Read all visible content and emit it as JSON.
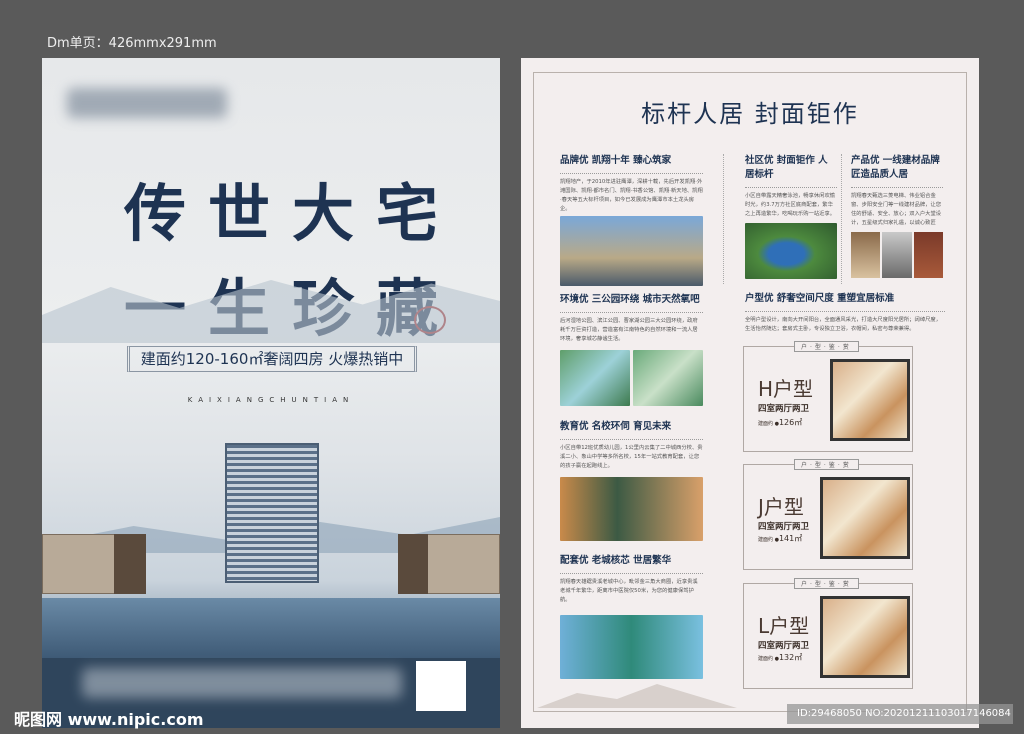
{
  "header": {
    "dimension_label": "Dm单页：426mmx291mm"
  },
  "left_poster": {
    "title_line1": "传世大宅",
    "title_line2": "一生珍藏",
    "tagline": "建面约120-160㎡奢阔四房  火爆热销中",
    "english": "KAIXIANGCHUNTIAN"
  },
  "right_poster": {
    "title": "标杆人居 封面钜作",
    "sections": [
      {
        "heading": "品牌优 凯翔十年 臻心筑家",
        "body": "凯翔地产，于2010年进驻鹰潭，深耕十载，先后开发凯翔·外滩国际、凯翔·都市名门、凯翔·书香公馆、凯翔·新天地、凯翔·春天等五大标杆项目，如今已发展成为鹰潭市本土龙头房企。"
      },
      {
        "heading": "社区优 封面钜作 人居标杆",
        "body": "小区自带露天精奢泳池，畅享休闲欢愉时光，约3.7万方社区底商配套，繁华之上再造繁华，吃喝玩乐购一站近享。"
      },
      {
        "heading": "产品优 一线建材品牌 匠造品质人居",
        "body": "凯翔春天甄选三菱电梯、伟业铝合金窗、步阳安全门等一线建材品牌，让您住的舒适、安全、放心；双入户大堂设计，五星级式归家礼遇，以诚心致匠"
      },
      {
        "heading": "环境优 三公园环绕 城市天然氧吧",
        "body": "后河湿地公园、滨江公园、曹家湖公园三大公园环绕，政府耗千万巨资打造，营造富有江南特色的自然环境和一流人居环境，奢享城芯静谧生活。"
      },
      {
        "heading": "户型优 舒奢空间尺度 重塑宜居标准",
        "body": "全明户型设计，南向大开间阳台，全面通风采光，打造大尺度阳光居所；阔绰尺度，生活怡然随达；套房式主卧，专设独立卫浴，衣帽间，私密与尊荣兼得。"
      },
      {
        "heading": "教育优 名校环伺 育见未来",
        "body": "小区自带12班优质幼儿园，1公里内云集了二中城西分校、贵溪二小、象山中学等多所名校，15年一站式教育配套，让您的孩子赢在起跑线上。"
      },
      {
        "heading": "配套优 老城核芯 世居繁华",
        "body": "凯翔春天雄踞贵溪老城中心，毗邻金三角大商圈，近享贵溪老城千年繁华，距离市中医院仅50米，为您的健康保驾护航。"
      }
    ],
    "plan_tag": "户·型·鉴·赏",
    "plans": [
      {
        "type": "H户型",
        "rooms": "四室两厅两卫",
        "area": "126㎡",
        "area_label": "建面约 ●"
      },
      {
        "type": "J户型",
        "rooms": "四室两厅两卫",
        "area": "141㎡",
        "area_label": "建面约 ●"
      },
      {
        "type": "L户型",
        "rooms": "四室两厅两卫",
        "area": "132㎡",
        "area_label": "建面约 ●"
      }
    ]
  },
  "watermark": {
    "site": "昵图网 www.nipic.com",
    "id": "ID:29468050 NO:20201211103017146084"
  }
}
